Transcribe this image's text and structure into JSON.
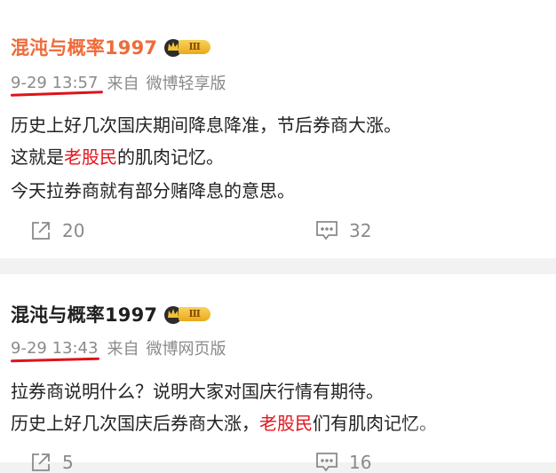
{
  "posts": [
    {
      "author": "混沌与概率1997",
      "badge_level": "Ⅲ",
      "time": "9-29 13:57",
      "from_label": "来自",
      "source": "微博轻享版",
      "lines": [
        {
          "pre": "历史上好几次国庆期间降息降准，节后券商大涨。",
          "highlight": "",
          "post": ""
        },
        {
          "pre": "这就是",
          "highlight": "老股民",
          "post": "的肌肉记忆。"
        },
        {
          "pre": "今天拉券商就有部分赌降息的意思。",
          "highlight": "",
          "post": ""
        }
      ],
      "repost_count": "20",
      "comment_count": "32"
    },
    {
      "author": "混沌与概率1997",
      "badge_level": "Ⅲ",
      "time": "9-29 13:43",
      "from_label": "来自",
      "source": "微博网页版",
      "lines": [
        {
          "pre": "拉券商说明什么？说明大家对国庆行情有期待。",
          "highlight": "",
          "post": ""
        },
        {
          "pre": "历史上好几次国庆后券商大涨，",
          "highlight": "老股民",
          "post": "们有肌肉记忆。"
        }
      ],
      "repost_count": "5",
      "comment_count": "16"
    }
  ],
  "icons": {
    "repost": "share-out-icon",
    "comment": "comment-bubble-icon",
    "badge": "crown-icon"
  },
  "colors": {
    "author_highlight": "#ef6b3a",
    "keyword_red": "#e3141d",
    "underline_red": "#e0121a"
  }
}
